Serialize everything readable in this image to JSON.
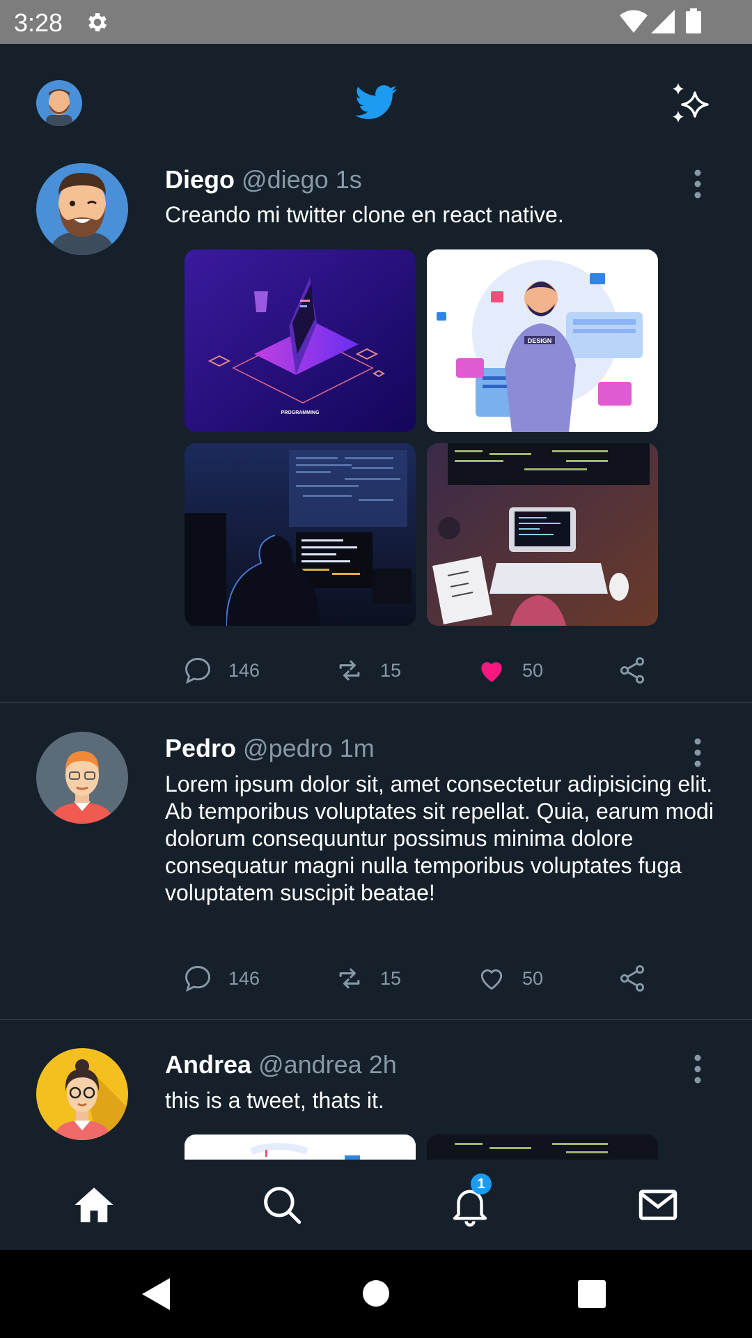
{
  "status_bar": {
    "time": "3:28"
  },
  "app": {
    "accent": "#1d9bf0",
    "like_color": "#f91880",
    "background": "#15202b"
  },
  "tweets": [
    {
      "name": "Diego",
      "handle": "@diego",
      "time": "1s",
      "content": "Creando mi twitter clone en react native.",
      "images": [
        "programming-laptop-illustration",
        "designer-character-illustration",
        "programmer-at-monitors-photo",
        "desk-with-code-screens-photo"
      ],
      "image_caption": "PROGRAMMING",
      "design_label": "DESIGN",
      "comments": "146",
      "retweets": "15",
      "likes": "50",
      "liked": true
    },
    {
      "name": "Pedro",
      "handle": "@pedro",
      "time": "1m",
      "content": "Lorem ipsum dolor sit, amet consectetur adipisicing elit. Ab temporibus voluptates sit repellat. Quia, earum modi dolorum consequuntur possimus minima dolore consequatur magni nulla temporibus voluptates fuga voluptatem suscipit beatae!",
      "comments": "146",
      "retweets": "15",
      "likes": "50",
      "liked": false
    },
    {
      "name": "Andrea",
      "handle": "@andrea",
      "time": "2h",
      "content": "this is a tweet, thats it."
    }
  ],
  "bottom_nav": {
    "items": [
      "home-icon",
      "search-icon",
      "notifications-icon",
      "messages-icon"
    ],
    "notification_count": "1"
  }
}
